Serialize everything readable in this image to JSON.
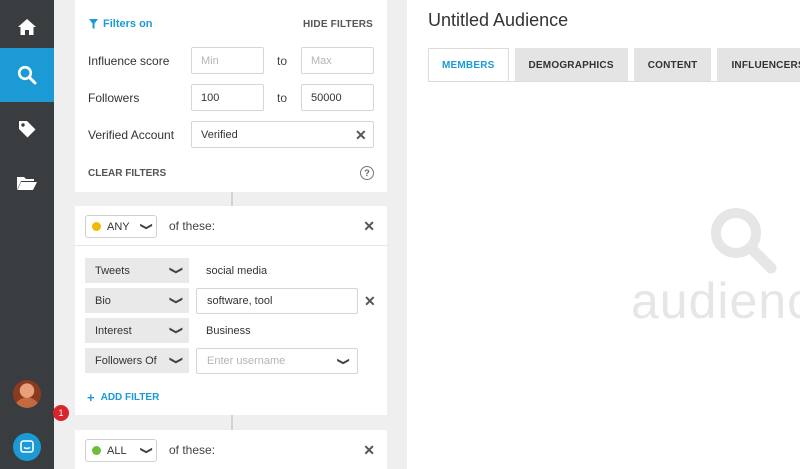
{
  "nav": {
    "items": [
      {
        "icon": "home-icon"
      },
      {
        "icon": "search-icon",
        "active": true
      },
      {
        "icon": "tag-icon"
      },
      {
        "icon": "folder-icon"
      }
    ],
    "notification_count": "1",
    "colors": {
      "background": "#3a3d40",
      "active": "#1b9ad6",
      "badge": "#d9242b"
    }
  },
  "filters": {
    "status_label": "Filters on",
    "hide_label": "HIDE FILTERS",
    "influence": {
      "label": "Influence score",
      "min_placeholder": "Min",
      "to": "to",
      "max_placeholder": "Max"
    },
    "followers": {
      "label": "Followers",
      "min_value": "100",
      "to": "to",
      "max_value": "50000"
    },
    "verified": {
      "label": "Verified Account",
      "value": "Verified"
    },
    "clear_label": "CLEAR FILTERS",
    "help_glyph": "?"
  },
  "groups": [
    {
      "selector": "ANY",
      "dot_color": "#f5b800",
      "suffix": "of these:",
      "rows": [
        {
          "field": "Tweets",
          "value": "social media"
        },
        {
          "field": "Bio",
          "value": "software, tool"
        },
        {
          "field": "Interest",
          "value": "Business"
        },
        {
          "field": "Followers Of",
          "placeholder": "Enter username"
        }
      ],
      "add_filter_label": "ADD FILTER"
    },
    {
      "selector": "ALL",
      "dot_color": "#6dbf3b",
      "suffix": "of these:"
    }
  ],
  "main": {
    "title": "Untitled Audience",
    "tabs": [
      {
        "label": "MEMBERS",
        "active": true
      },
      {
        "label": "DEMOGRAPHICS"
      },
      {
        "label": "CONTENT"
      },
      {
        "label": "INFLUENCERS"
      }
    ],
    "watermark": "audienc"
  },
  "accent_color": "#1b9ad6"
}
